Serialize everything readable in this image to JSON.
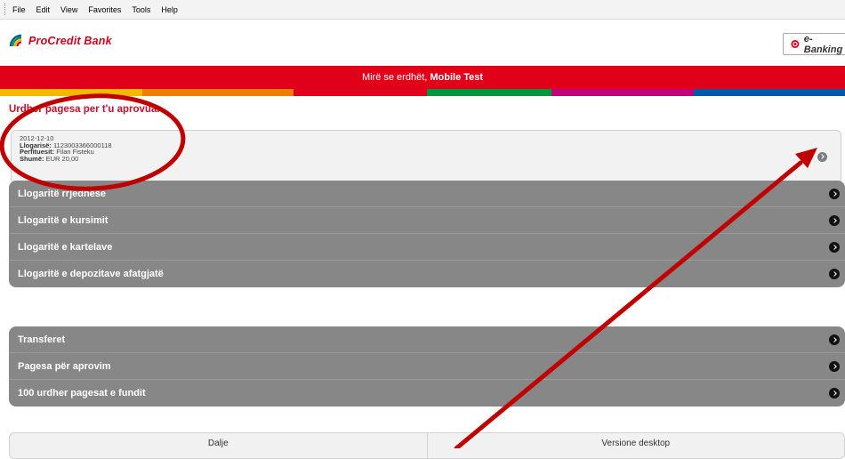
{
  "menubar": {
    "items": [
      "File",
      "Edit",
      "View",
      "Favorites",
      "Tools",
      "Help"
    ]
  },
  "header": {
    "brand": "ProCredit Bank",
    "ebanking_label": "e-Banking"
  },
  "welcome": {
    "prefix": "Mirë se erdhët, ",
    "user": "Mobile Test"
  },
  "stripe_colors": [
    "#f5b800",
    "#f07d00",
    "#e3001b",
    "#009640",
    "#009fe3",
    "#c2007a",
    "#0059a6"
  ],
  "pending": {
    "title": "Urdher pagesa per t'u aprovuar",
    "date": "2012-12-10",
    "account_label": "Llogarisë:",
    "account_value": "1123003366000118",
    "beneficiary_label": "Perfituesit:",
    "beneficiary_value": "Filan Fisteku",
    "amount_label": "Shumë:",
    "amount_value": "EUR  20,00"
  },
  "accounts_menu": [
    "Llogaritë rrjedhëse",
    "Llogaritë e kursimit",
    "Llogaritë e kartelave",
    "Llogaritë e depozitave afatgjatë"
  ],
  "payments_menu": [
    "Transferet",
    "Pagesa për aprovim",
    "100 urdher pagesat e fundit"
  ],
  "bottom": {
    "logout": "Dalje",
    "desktop": "Versione desktop"
  },
  "annotation_color": "#c00000"
}
